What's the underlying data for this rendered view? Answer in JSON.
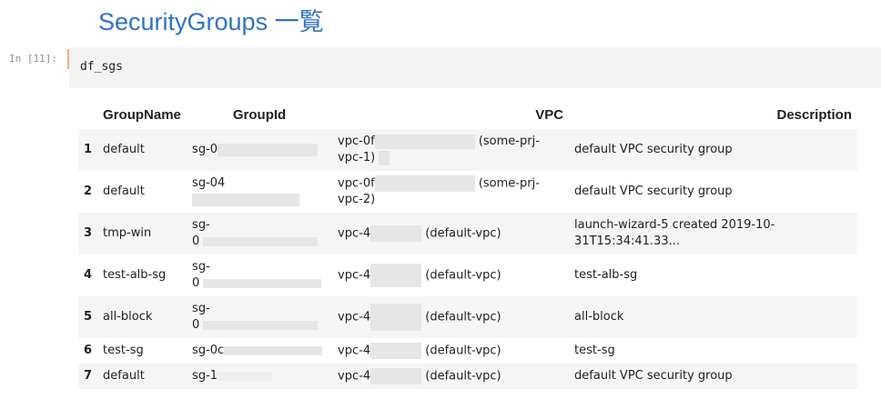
{
  "notebook": {
    "heading": "SecurityGroups 一覧",
    "prompt": "In [11]:",
    "code": "df_sgs"
  },
  "table": {
    "columns": [
      "",
      "GroupName",
      "GroupId",
      "VPC",
      "Description"
    ],
    "rows": [
      {
        "index": "1",
        "name": "default",
        "group_id": "sg-0",
        "vpc": "vpc-0f",
        "vpc_suffix": "(some-prj-",
        "vpc_line2": "vpc-1)",
        "description": "default VPC security group"
      },
      {
        "index": "2",
        "name": "default",
        "group_id": "sg-04",
        "vpc": "vpc-0f",
        "vpc_suffix": "(some-prj-",
        "vpc_line2": "vpc-2)",
        "description": "default VPC security group"
      },
      {
        "index": "3",
        "name": "tmp-win",
        "group_id": "sg-",
        "group_id_line2": "0",
        "vpc": "vpc-4",
        "vpc_suffix": "(default-vpc)",
        "description": "launch-wizard-5 created 2019-10-31T15:34:41.33..."
      },
      {
        "index": "4",
        "name": "test-alb-sg",
        "group_id": "sg-",
        "group_id_line2": "0",
        "vpc": "vpc-4",
        "vpc_suffix": "(default-vpc)",
        "description": "test-alb-sg"
      },
      {
        "index": "5",
        "name": "all-block",
        "group_id": "sg-",
        "group_id_line2": "0",
        "vpc": "vpc-4",
        "vpc_suffix": "(default-vpc)",
        "description": "all-block"
      },
      {
        "index": "6",
        "name": "test-sg",
        "group_id": "sg-0c",
        "vpc": "vpc-4",
        "vpc_suffix": "(default-vpc)",
        "description": "test-sg"
      },
      {
        "index": "7",
        "name": "default",
        "group_id": "sg-1",
        "vpc": "vpc-4",
        "vpc_suffix": "(default-vpc)",
        "description": "default VPC security group"
      }
    ]
  }
}
